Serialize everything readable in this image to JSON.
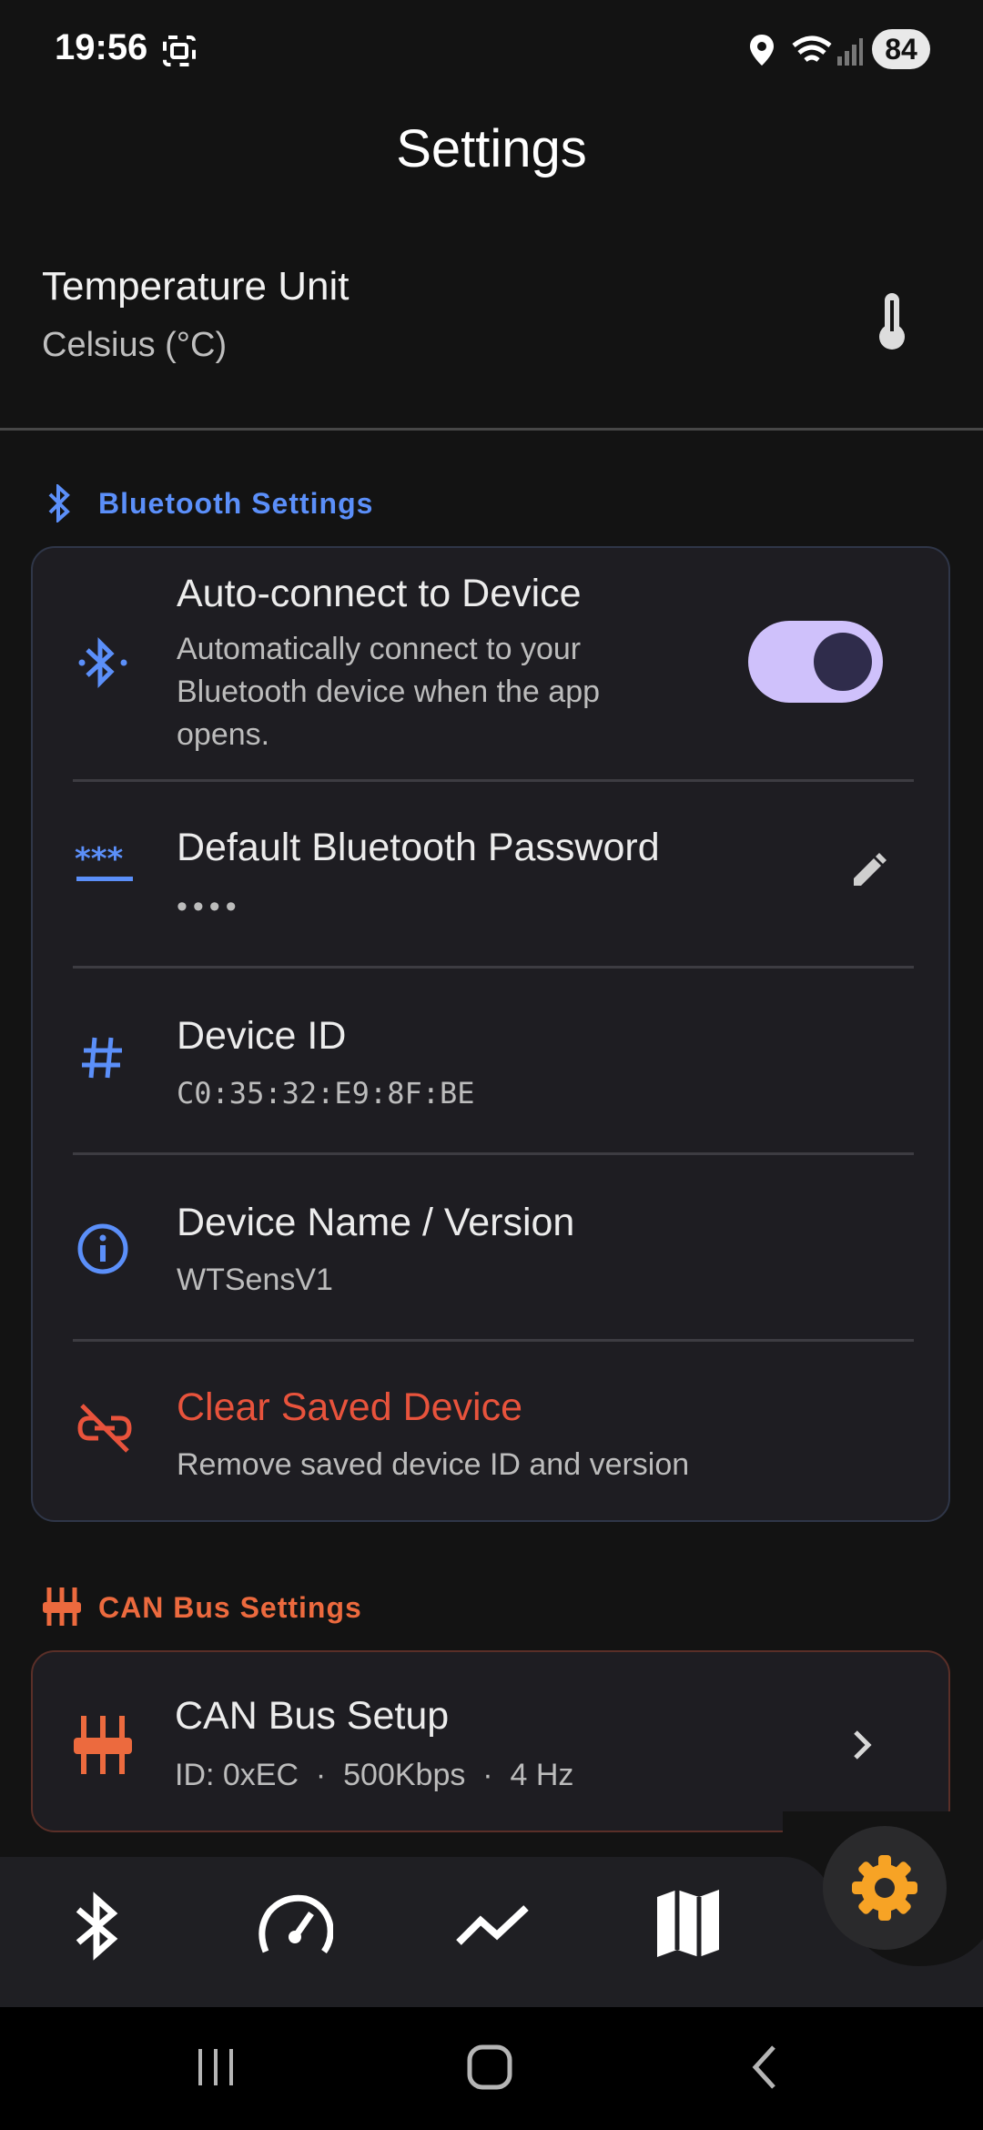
{
  "status_bar": {
    "time": "19:56",
    "battery": "84",
    "icons": [
      "screenshot-icon",
      "location-icon",
      "wifi-icon",
      "signal-icon",
      "battery-icon"
    ]
  },
  "header": {
    "title": "Settings"
  },
  "temperature": {
    "title": "Temperature Unit",
    "value": "Celsius (°C)",
    "icon": "thermometer-icon"
  },
  "bluetooth_section": {
    "heading": "Bluetooth Settings",
    "accent": "#5b8ff9",
    "items": [
      {
        "title": "Auto-connect to Device",
        "subtitle_lines": [
          "Automatically connect to your",
          "Bluetooth device when the app",
          "opens."
        ],
        "toggle_on": true,
        "icon": "bluetooth-searching-icon"
      },
      {
        "title": "Default Bluetooth Password",
        "value": "••••",
        "icon": "password-icon",
        "action_icon": "edit-icon"
      },
      {
        "title": "Device ID",
        "value": "C0:35:32:E9:8F:BE",
        "icon": "hash-icon"
      },
      {
        "title": "Device Name / Version",
        "value": "WTSensV1",
        "icon": "info-icon"
      },
      {
        "title": "Clear Saved Device",
        "value": "Remove saved device ID and version",
        "icon": "link-off-icon",
        "danger_color": "#e8533c"
      }
    ]
  },
  "can_section": {
    "heading": "CAN Bus Settings",
    "accent": "#ec6a3e",
    "item": {
      "title": "CAN Bus Setup",
      "subtitle": "ID: 0xEC  ·  500Kbps  ·  4 Hz",
      "icon": "can-bus-icon",
      "action_icon": "chevron-right-icon"
    }
  },
  "bottom_nav": {
    "items": [
      "bluetooth-icon",
      "speedometer-icon",
      "chart-line-icon",
      "map-icon",
      "settings-icon"
    ],
    "active": "settings-icon",
    "active_color": "#f7a325"
  },
  "system_nav": [
    "recents-icon",
    "home-icon",
    "back-icon"
  ]
}
